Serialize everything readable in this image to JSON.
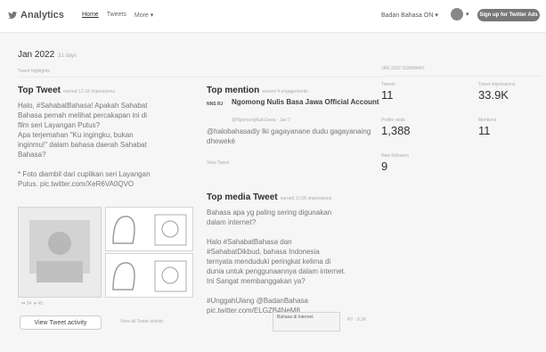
{
  "header": {
    "brand": "Analytics",
    "nav": [
      "Home",
      "Tweets",
      "More ▾"
    ],
    "account": "Badan Bahasa ON ▾",
    "avatar_chevron": "▾",
    "signup": "Sign up for Twitter Ads"
  },
  "period": {
    "month": "Jan 2022",
    "days": "31 days",
    "summary": "Tweet highlights"
  },
  "top_tweet": {
    "title": "Top Tweet",
    "meta": "earned 12.1K impressions",
    "text": [
      "Halo, #SahabatBahasa! Apakah Sahabat",
      "Bahasa pernah melihat percakapan ini di",
      "film seri Layangan Putus?",
      "Apa terjemahan \"Ku ingingku, bukan",
      "inginmu!\" dalam bahasa daerah Sahabat",
      "Bahasa?",
      "",
      "* Foto diambil dari cuplikan seri Layangan",
      "Putus. pic.twitter.com/XeR6VA0QVO"
    ],
    "engagement": [
      "24",
      "40"
    ],
    "button": "View Tweet activity",
    "link": "View all Tweet activity"
  },
  "top_mention": {
    "title": "Top mention",
    "meta": "earned 4 engagements",
    "logo_text": "NNS RJ",
    "account_name": "Ngomong Nulis Basa Jawa Official Account",
    "handle": "@NgomongNulisJawa · Jan 7",
    "text": "@halobahasadiy Iki gagayanane dudu gagayanaing dhewekè",
    "link": "View Tweet"
  },
  "top_media": {
    "title": "Top media Tweet",
    "meta": "earned 11.5K impressions",
    "text": [
      "Bahasa apa yg paling sering digunakan",
      "dalam internet?",
      "",
      "Halo #SahabatBahasa dan",
      "#SahabatDikbud, bahasa Indonesia",
      "ternyata menduduki peringkat kelima di",
      "dunia untuk penggunaannya dalam internet.",
      "Ini Sangat membanggakan ya?",
      "",
      "#UnggahUlang @BadanBahasa",
      "pic.twitter.com/ELGZB4NeM8"
    ],
    "thumb_caption": "Bahasa di Internet",
    "share": "RT · 8.2K"
  },
  "stats": {
    "heading": "JAN 2022 SUMMARY",
    "items": [
      {
        "label": "Tweets",
        "value": "11"
      },
      {
        "label": "Tweet impressions",
        "value": "33.9K"
      },
      {
        "label": "Profile visits",
        "value": "1,388"
      },
      {
        "label": "Mentions",
        "value": "11"
      },
      {
        "label": "New followers",
        "value": "9"
      }
    ]
  }
}
